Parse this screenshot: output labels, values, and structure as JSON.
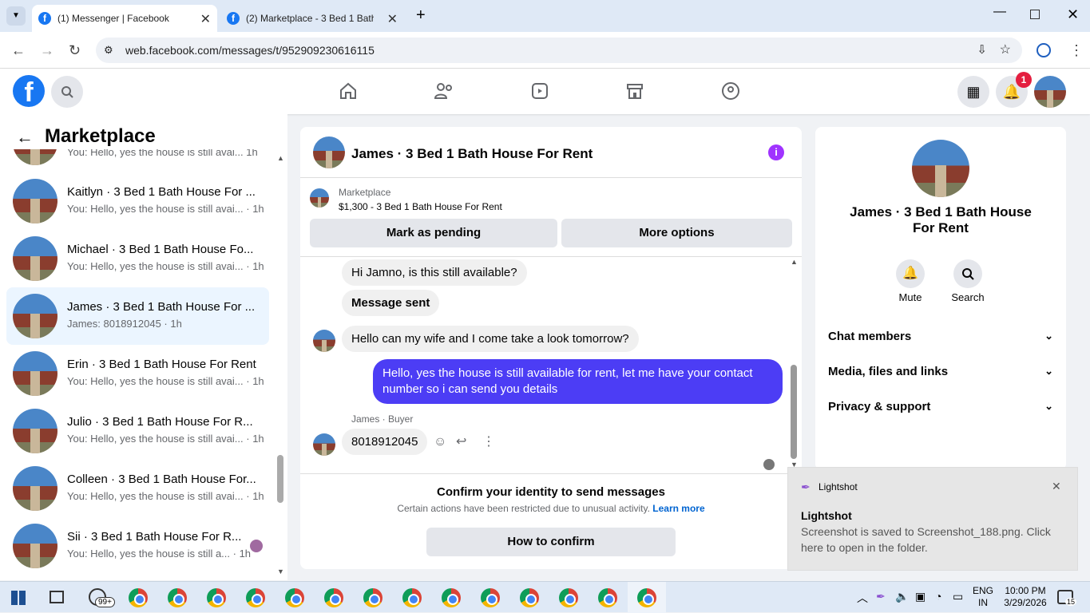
{
  "browser": {
    "tabs": [
      {
        "title": "(1) Messenger | Facebook"
      },
      {
        "title": "(2) Marketplace - 3 Bed 1 Bath"
      }
    ],
    "url": "web.facebook.com/messages/t/952909230616115"
  },
  "fb_header": {
    "notification_count": "1"
  },
  "sidebar": {
    "title": "Marketplace",
    "partial_preview": "You: Hello, yes the house is still avai... 1h",
    "conversations": [
      {
        "name": "Kaitlyn · 3 Bed 1 Bath House For ...",
        "preview": "You: Hello, yes the house is still avai... · 1h"
      },
      {
        "name": "Michael · 3 Bed 1 Bath House Fo...",
        "preview": "You: Hello, yes the house is still avai... · 1h"
      },
      {
        "name": "James · 3 Bed 1 Bath House For ...",
        "preview": "James: 8018912045 · 1h"
      },
      {
        "name": "Erin · 3 Bed 1 Bath House For Rent",
        "preview": "You: Hello, yes the house is still avai... · 1h"
      },
      {
        "name": "Julio · 3 Bed 1 Bath House For R...",
        "preview": "You: Hello, yes the house is still avai... · 1h"
      },
      {
        "name": "Colleen · 3 Bed 1 Bath House For...",
        "preview": "You: Hello, yes the house is still avai... · 1h"
      },
      {
        "name": "Sii · 3 Bed 1 Bath House For R...",
        "preview": "You: Hello, yes the house is still a... · 1h"
      }
    ]
  },
  "chat": {
    "title": "James · 3 Bed 1 Bath House For Rent",
    "listing_source": "Marketplace",
    "listing": "$1,300 - 3 Bed 1 Bath House For Rent",
    "mark_pending": "Mark as pending",
    "more_options": "More options",
    "messages": {
      "m1": "Hi Jamno, is this still available?",
      "m2": "Message sent",
      "m3": "Hello can my wife and I  come take a look tomorrow?",
      "m4": "Hello, yes the house is still available for rent, let me have your contact number so i can send you  details",
      "sender_label": "James · Buyer",
      "m5": "8018912045"
    },
    "confirm_title": "Confirm your identity to send messages",
    "confirm_text": "Certain actions have been restricted due to unusual activity.",
    "learn_more": "Learn more",
    "how_to_confirm": "How to confirm"
  },
  "right_panel": {
    "name": "James · 3 Bed 1 Bath House For Rent",
    "mute": "Mute",
    "search": "Search",
    "sections": [
      "Chat members",
      "Media, files and links",
      "Privacy & support"
    ]
  },
  "toast": {
    "app": "Lightshot",
    "title": "Lightshot",
    "body": "Screenshot is saved to Screenshot_188.png. Click here to open in the folder."
  },
  "taskbar": {
    "whatsapp_badge": "99+",
    "lang1": "ENG",
    "lang2": "IN",
    "time": "10:00 PM",
    "date": "3/29/2026",
    "notif": "15"
  }
}
